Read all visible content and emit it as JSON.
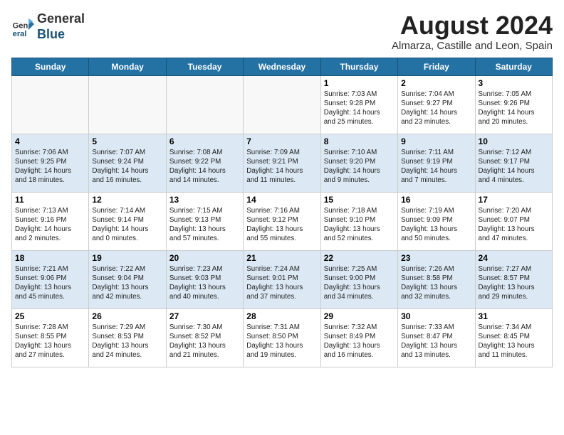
{
  "header": {
    "logo_general": "General",
    "logo_blue": "Blue",
    "month_year": "August 2024",
    "location": "Almarza, Castille and Leon, Spain"
  },
  "weekdays": [
    "Sunday",
    "Monday",
    "Tuesday",
    "Wednesday",
    "Thursday",
    "Friday",
    "Saturday"
  ],
  "weeks": [
    [
      {
        "day": "",
        "info": ""
      },
      {
        "day": "",
        "info": ""
      },
      {
        "day": "",
        "info": ""
      },
      {
        "day": "",
        "info": ""
      },
      {
        "day": "1",
        "info": "Sunrise: 7:03 AM\nSunset: 9:28 PM\nDaylight: 14 hours\nand 25 minutes."
      },
      {
        "day": "2",
        "info": "Sunrise: 7:04 AM\nSunset: 9:27 PM\nDaylight: 14 hours\nand 23 minutes."
      },
      {
        "day": "3",
        "info": "Sunrise: 7:05 AM\nSunset: 9:26 PM\nDaylight: 14 hours\nand 20 minutes."
      }
    ],
    [
      {
        "day": "4",
        "info": "Sunrise: 7:06 AM\nSunset: 9:25 PM\nDaylight: 14 hours\nand 18 minutes."
      },
      {
        "day": "5",
        "info": "Sunrise: 7:07 AM\nSunset: 9:24 PM\nDaylight: 14 hours\nand 16 minutes."
      },
      {
        "day": "6",
        "info": "Sunrise: 7:08 AM\nSunset: 9:22 PM\nDaylight: 14 hours\nand 14 minutes."
      },
      {
        "day": "7",
        "info": "Sunrise: 7:09 AM\nSunset: 9:21 PM\nDaylight: 14 hours\nand 11 minutes."
      },
      {
        "day": "8",
        "info": "Sunrise: 7:10 AM\nSunset: 9:20 PM\nDaylight: 14 hours\nand 9 minutes."
      },
      {
        "day": "9",
        "info": "Sunrise: 7:11 AM\nSunset: 9:19 PM\nDaylight: 14 hours\nand 7 minutes."
      },
      {
        "day": "10",
        "info": "Sunrise: 7:12 AM\nSunset: 9:17 PM\nDaylight: 14 hours\nand 4 minutes."
      }
    ],
    [
      {
        "day": "11",
        "info": "Sunrise: 7:13 AM\nSunset: 9:16 PM\nDaylight: 14 hours\nand 2 minutes."
      },
      {
        "day": "12",
        "info": "Sunrise: 7:14 AM\nSunset: 9:14 PM\nDaylight: 14 hours\nand 0 minutes."
      },
      {
        "day": "13",
        "info": "Sunrise: 7:15 AM\nSunset: 9:13 PM\nDaylight: 13 hours\nand 57 minutes."
      },
      {
        "day": "14",
        "info": "Sunrise: 7:16 AM\nSunset: 9:12 PM\nDaylight: 13 hours\nand 55 minutes."
      },
      {
        "day": "15",
        "info": "Sunrise: 7:18 AM\nSunset: 9:10 PM\nDaylight: 13 hours\nand 52 minutes."
      },
      {
        "day": "16",
        "info": "Sunrise: 7:19 AM\nSunset: 9:09 PM\nDaylight: 13 hours\nand 50 minutes."
      },
      {
        "day": "17",
        "info": "Sunrise: 7:20 AM\nSunset: 9:07 PM\nDaylight: 13 hours\nand 47 minutes."
      }
    ],
    [
      {
        "day": "18",
        "info": "Sunrise: 7:21 AM\nSunset: 9:06 PM\nDaylight: 13 hours\nand 45 minutes."
      },
      {
        "day": "19",
        "info": "Sunrise: 7:22 AM\nSunset: 9:04 PM\nDaylight: 13 hours\nand 42 minutes."
      },
      {
        "day": "20",
        "info": "Sunrise: 7:23 AM\nSunset: 9:03 PM\nDaylight: 13 hours\nand 40 minutes."
      },
      {
        "day": "21",
        "info": "Sunrise: 7:24 AM\nSunset: 9:01 PM\nDaylight: 13 hours\nand 37 minutes."
      },
      {
        "day": "22",
        "info": "Sunrise: 7:25 AM\nSunset: 9:00 PM\nDaylight: 13 hours\nand 34 minutes."
      },
      {
        "day": "23",
        "info": "Sunrise: 7:26 AM\nSunset: 8:58 PM\nDaylight: 13 hours\nand 32 minutes."
      },
      {
        "day": "24",
        "info": "Sunrise: 7:27 AM\nSunset: 8:57 PM\nDaylight: 13 hours\nand 29 minutes."
      }
    ],
    [
      {
        "day": "25",
        "info": "Sunrise: 7:28 AM\nSunset: 8:55 PM\nDaylight: 13 hours\nand 27 minutes."
      },
      {
        "day": "26",
        "info": "Sunrise: 7:29 AM\nSunset: 8:53 PM\nDaylight: 13 hours\nand 24 minutes."
      },
      {
        "day": "27",
        "info": "Sunrise: 7:30 AM\nSunset: 8:52 PM\nDaylight: 13 hours\nand 21 minutes."
      },
      {
        "day": "28",
        "info": "Sunrise: 7:31 AM\nSunset: 8:50 PM\nDaylight: 13 hours\nand 19 minutes."
      },
      {
        "day": "29",
        "info": "Sunrise: 7:32 AM\nSunset: 8:49 PM\nDaylight: 13 hours\nand 16 minutes."
      },
      {
        "day": "30",
        "info": "Sunrise: 7:33 AM\nSunset: 8:47 PM\nDaylight: 13 hours\nand 13 minutes."
      },
      {
        "day": "31",
        "info": "Sunrise: 7:34 AM\nSunset: 8:45 PM\nDaylight: 13 hours\nand 11 minutes."
      }
    ]
  ]
}
